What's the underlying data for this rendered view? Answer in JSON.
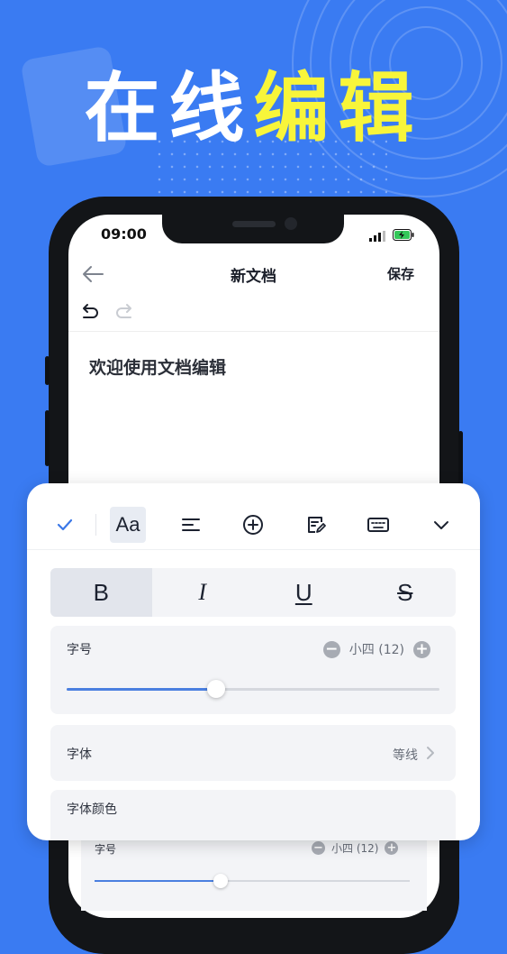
{
  "headline": {
    "part1": "在线",
    "part2": "编辑"
  },
  "status_bar": {
    "time": "09:00"
  },
  "nav": {
    "title": "新文档",
    "save_label": "保存"
  },
  "document": {
    "body_text": "欢迎使用文档编辑"
  },
  "toolbar": {
    "items": [
      "check-icon",
      "font-style-icon",
      "align-icon",
      "add-circle-icon",
      "note-edit-icon",
      "keyboard-icon",
      "chevron-down-icon"
    ],
    "active": "font-style-icon",
    "font_style_glyph": "Aa"
  },
  "format_buttons": [
    {
      "label": "B",
      "name": "bold",
      "active": true
    },
    {
      "label": "I",
      "name": "italic",
      "active": false
    },
    {
      "label": "U",
      "name": "underline",
      "active": false
    },
    {
      "label": "S",
      "name": "strikethrough",
      "active": false
    }
  ],
  "font_size": {
    "label": "字号",
    "minus": "−",
    "plus": "+",
    "value": "小四 (12)",
    "slider_fraction": 0.4
  },
  "font_family": {
    "label": "字体",
    "value": "等线"
  },
  "font_color": {
    "label": "字体颜色"
  },
  "background_panel": {
    "label": "字号",
    "value": "小四 (12)",
    "minus": "−",
    "plus": "+",
    "slider_fraction": 0.4
  },
  "colors": {
    "background": "#3a7bf2",
    "headline_accent": "#f8f53a",
    "slider_fill": "#4a7fe0",
    "phone_frame": "#131518"
  }
}
